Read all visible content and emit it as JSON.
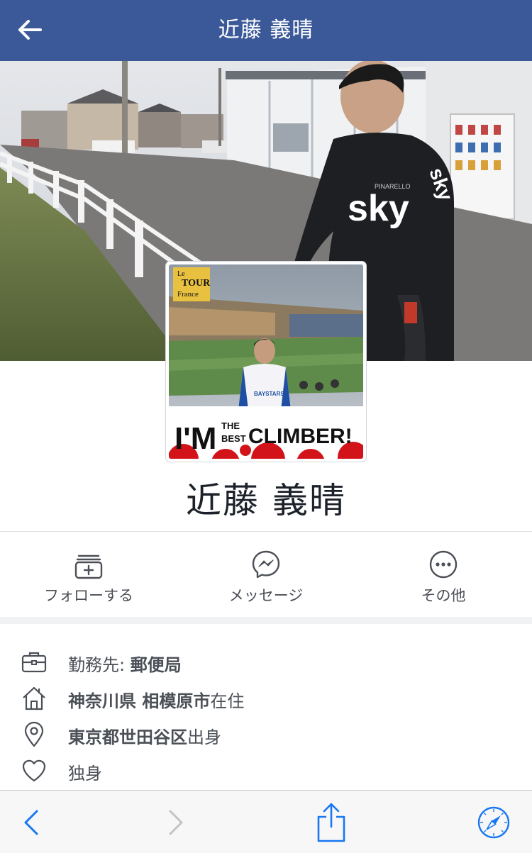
{
  "header": {
    "title": "近藤 義晴"
  },
  "cover_picture": {
    "lettering": [
      "sky",
      "PINARELLO",
      "sky"
    ]
  },
  "profile_picture": {
    "lettering_logo": [
      "Le",
      "TOUR",
      "France"
    ],
    "lettering_banner_big": "I'M",
    "lettering_banner_small": [
      "THE",
      "BEST"
    ],
    "lettering_banner_right": "CLIMBER!",
    "lettering_shirt": "BAYSTARS"
  },
  "profile": {
    "name": "近藤 義晴"
  },
  "actions": [
    {
      "label": "フォローする",
      "icon": "follow-icon"
    },
    {
      "label": "メッセージ",
      "icon": "messenger-icon"
    },
    {
      "label": "その他",
      "icon": "more-icon"
    }
  ],
  "info": {
    "work": {
      "prefix": "勤務先: ",
      "place": "郵便局",
      "icon": "briefcase-icon"
    },
    "lives": {
      "place": "神奈川県 相模原市",
      "suffix": "在住",
      "icon": "home-icon"
    },
    "from": {
      "place": "東京都世田谷区",
      "suffix": "出身",
      "icon": "location-pin-icon"
    },
    "relationship": {
      "status": "独身",
      "icon": "heart-icon"
    }
  },
  "browser_bar": {
    "icons": [
      "back-arrow-icon",
      "forward-arrow-icon",
      "share-icon",
      "safari-compass-icon"
    ]
  },
  "colors": {
    "header": "#3b5998",
    "link_blue": "#1877f2",
    "text_gray": "#4b4f56"
  }
}
